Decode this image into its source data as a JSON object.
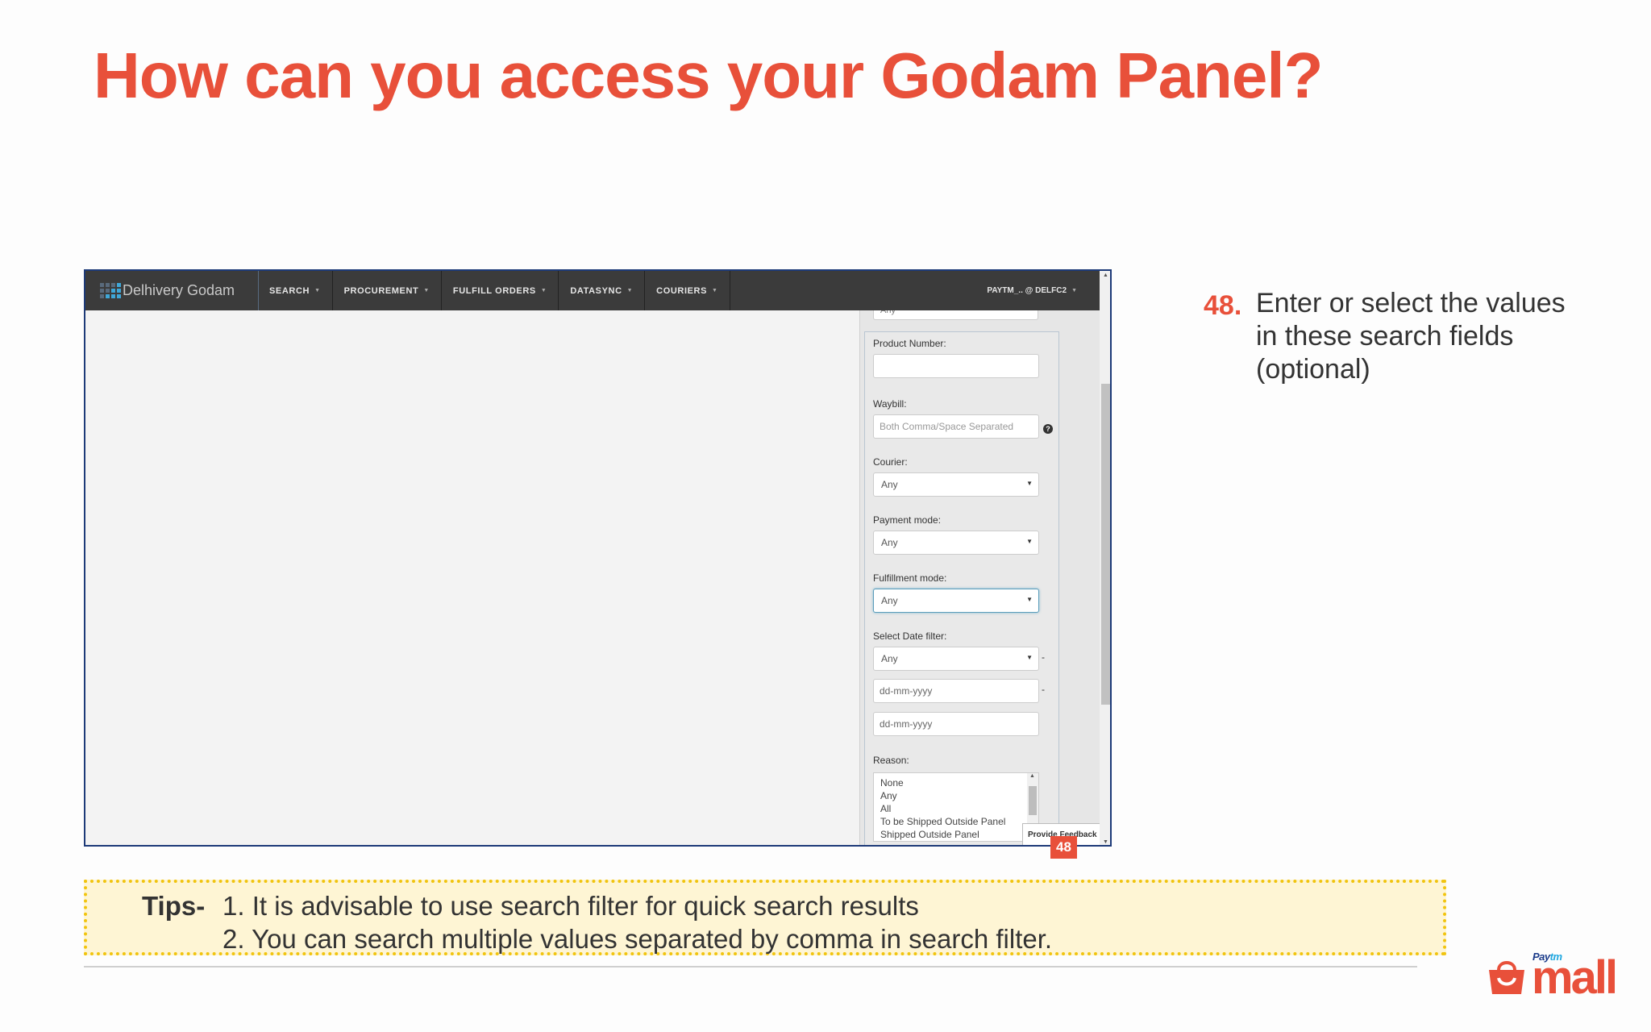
{
  "slide": {
    "title": "How can you access your Godam Panel?"
  },
  "app": {
    "brand": "Delhivery Godam",
    "nav": [
      {
        "label": "SEARCH"
      },
      {
        "label": "PROCUREMENT"
      },
      {
        "label": "FULFILL ORDERS"
      },
      {
        "label": "DATASYNC"
      },
      {
        "label": "COURIERS"
      }
    ],
    "user": "PAYTM_.. @ DELFC2",
    "cut_field_value": "Any",
    "filters": {
      "product_number_label": "Product Number:",
      "product_number_value": "",
      "waybill_label": "Waybill:",
      "waybill_placeholder": "Both Comma/Space Separated",
      "courier_label": "Courier:",
      "courier_value": "Any",
      "payment_mode_label": "Payment mode:",
      "payment_mode_value": "Any",
      "fulfillment_mode_label": "Fulfillment mode:",
      "fulfillment_mode_value": "Any",
      "date_filter_label": "Select Date filter:",
      "date_filter_value": "Any",
      "date_from_placeholder": "dd-mm-yyyy",
      "date_to_placeholder": "dd-mm-yyyy",
      "reason_label": "Reason:",
      "reason_options": [
        "None",
        "Any",
        "All",
        "To be Shipped Outside Panel",
        "Shipped Outside Panel"
      ]
    },
    "feedback_tab": "Provide Feedback"
  },
  "step": {
    "number": "48.",
    "badge": "48",
    "text": "Enter or select the values in these search fields (optional)"
  },
  "tips": {
    "label": "Tips-",
    "line1": "1. It is advisable to use search filter for quick search results",
    "line2": "2. You can search multiple values separated by comma  in search filter."
  },
  "logo": {
    "paytm_left": "Pay",
    "paytm_right": "tm",
    "mall": "mall"
  },
  "colors": {
    "accent": "#e8503a",
    "navbar": "#3b3b3b",
    "frame_border": "#1d3a78",
    "tips_bg": "#fef5d4",
    "tips_border": "#f1c40f"
  }
}
